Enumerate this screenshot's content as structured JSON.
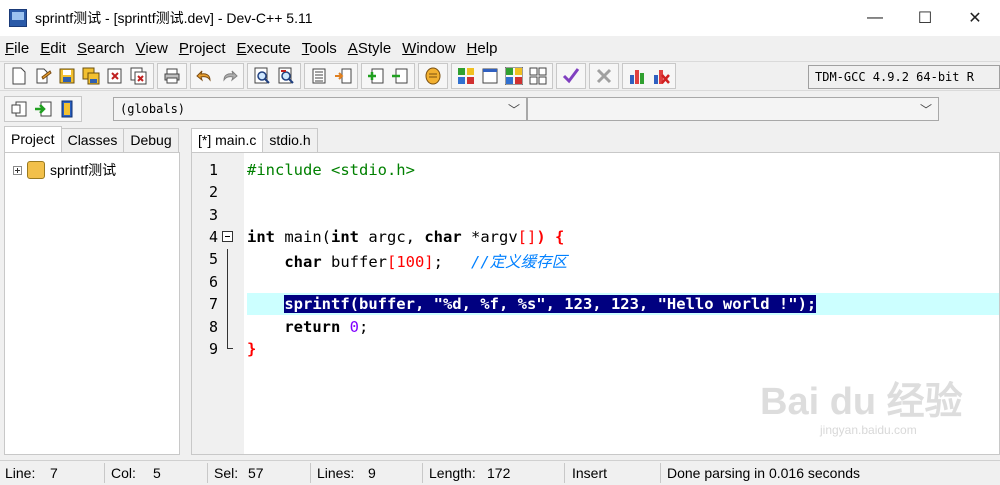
{
  "window": {
    "title": "sprintf测试 - [sprintf测试.dev] - Dev-C++ 5.11",
    "minimize": "—",
    "maximize": "☐",
    "close": "✕"
  },
  "menu": [
    {
      "first": "F",
      "rest": "ile"
    },
    {
      "first": "E",
      "rest": "dit"
    },
    {
      "first": "S",
      "rest": "earch"
    },
    {
      "first": "V",
      "rest": "iew"
    },
    {
      "first": "P",
      "rest": "roject"
    },
    {
      "first": "E",
      "rest": "xecute"
    },
    {
      "first": "T",
      "rest": "ools"
    },
    {
      "first": "A",
      "rest": "Style"
    },
    {
      "first": "W",
      "rest": "indow"
    },
    {
      "first": "H",
      "rest": "elp"
    }
  ],
  "toolbar": {
    "compiler": "TDM-GCC 4.9.2 64-bit R",
    "scope_combo": "(globals)",
    "member_combo": ""
  },
  "left_panel": {
    "tabs": [
      "Project",
      "Classes",
      "Debug"
    ],
    "project_name": "sprintf测试"
  },
  "editor": {
    "tabs": [
      "[*] main.c",
      "stdio.h"
    ],
    "line_numbers": [
      "1",
      "2",
      "3",
      "4",
      "5",
      "6",
      "7",
      "8",
      "9"
    ],
    "lines": {
      "l1": "#include <stdio.h>",
      "l4_int": "int",
      "l4_main": " main(",
      "l4_int2": "int",
      "l4_argc": " argc, ",
      "l4_char": "char",
      "l4_star": " *argv",
      "l4_br": "[]",
      "l4_close": ") {",
      "l5_char": "char",
      "l5_buf": " buffer",
      "l5_idx": "[100]",
      "l5_semi": ";   ",
      "l5_comment": "//定义缓存区",
      "l7": "sprintf(buffer, \"%d, %f, %s\", 123, 123, \"Hello world !\");",
      "l8_return": "return",
      "l8_zero": " 0",
      "l8_semi": ";",
      "l9": "}"
    }
  },
  "watermark": {
    "main": "Bai du 经验",
    "sub": "jingyan.baidu.com"
  },
  "status": {
    "line_label": "Line:",
    "line_val": "7",
    "col_label": "Col:",
    "col_val": "5",
    "sel_label": "Sel:",
    "sel_val": "57",
    "lines_label": "Lines:",
    "lines_val": "9",
    "length_label": "Length:",
    "length_val": "172",
    "mode": "Insert",
    "message": "Done parsing in 0.016 seconds"
  }
}
